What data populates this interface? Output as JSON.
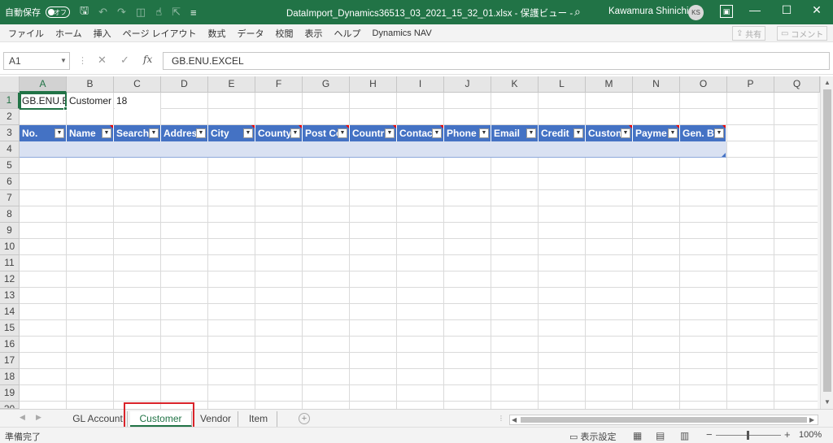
{
  "titlebar": {
    "autosave_label": "自動保存",
    "autosave_state": "オフ",
    "filename": "DataImport_Dynamics36513_03_2021_15_32_01.xlsx  -  保護ビュー  -",
    "user_name": "Kawamura Shinichi",
    "user_initials": "KS"
  },
  "menu": [
    "ファイル",
    "ホーム",
    "挿入",
    "ページ レイアウト",
    "数式",
    "データ",
    "校閲",
    "表示",
    "ヘルプ",
    "Dynamics NAV"
  ],
  "share_label": "共有",
  "comment_label": "コメント",
  "formula_bar": {
    "name_box": "A1",
    "formula": "GB.ENU.EXCEL"
  },
  "columns": [
    "A",
    "B",
    "C",
    "D",
    "E",
    "F",
    "G",
    "H",
    "I",
    "J",
    "K",
    "L",
    "M",
    "N",
    "O",
    "P",
    "Q"
  ],
  "rows": [
    "1",
    "2",
    "3",
    "4",
    "5",
    "6",
    "7",
    "8",
    "9",
    "10",
    "11",
    "12",
    "13",
    "14",
    "15",
    "16",
    "17",
    "18",
    "19",
    "20"
  ],
  "row1": {
    "a1": "GB.ENU.E",
    "b1": "Customer",
    "c1": "18"
  },
  "table_headers": [
    "No.",
    "Name",
    "Search",
    "Addres",
    "City",
    "County",
    "Post Co",
    "Countr",
    "Contac",
    "Phone",
    "Email",
    "Credit",
    "Custon",
    "Payme",
    "Gen. Bu"
  ],
  "sheet_tabs": [
    "GL Account",
    "Customer",
    "Vendor",
    "Item"
  ],
  "active_sheet": "Customer",
  "status": {
    "ready": "準備完了",
    "display_settings": "表示設定",
    "zoom": "100%"
  },
  "colors": {
    "excel_green": "#217346",
    "table_header": "#4472c4",
    "table_row": "#d9e1f2",
    "highlight": "#d9232a"
  }
}
